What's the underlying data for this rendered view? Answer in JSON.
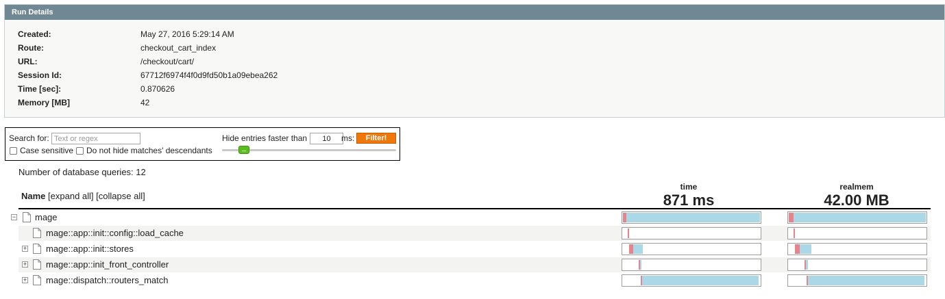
{
  "run_details": {
    "title": "Run Details",
    "rows": [
      {
        "label": "Created:",
        "value": "May 27, 2016 5:29:14 AM"
      },
      {
        "label": "Route:",
        "value": "checkout_cart_index"
      },
      {
        "label": "URL:",
        "value": "/checkout/cart/"
      },
      {
        "label": "Session Id:",
        "value": "67712f6974f4f0d9fd50b1a09ebea262"
      },
      {
        "label": "Time [sec]:",
        "value": "0.870626"
      },
      {
        "label": "Memory [MB]",
        "value": "42"
      }
    ]
  },
  "filter": {
    "search_label": "Search for:",
    "search_placeholder": "Text or regex",
    "case_sensitive_label": "Case sensitive",
    "no_hide_label": "Do not hide matches' descendants",
    "hide_label": "Hide entries faster than",
    "ms_value": "10",
    "ms_label": "ms:",
    "filter_button": "Filter!",
    "slider_glyph": "↔"
  },
  "db_queries": "Number of database queries: 12",
  "table": {
    "name_header": "Name",
    "expand_all": "[expand all]",
    "collapse_all": "[collapse all]",
    "time_header": "time",
    "time_total": "871 ms",
    "mem_header": "realmem",
    "mem_total": "42.00 MB",
    "rows": [
      {
        "label": "mage",
        "toggle": "−",
        "time": {
          "self": 0.025,
          "total": 1.0
        },
        "mem": {
          "self": 0.035,
          "total": 1.0
        }
      },
      {
        "label": "mage::app::init::config::load_cache",
        "toggle": "",
        "time": {
          "self": 0.01,
          "total": 0.01
        },
        "mem": {
          "self": 0.01,
          "total": 0.01
        }
      },
      {
        "label": "mage::app::init::stores",
        "toggle": "+",
        "time": {
          "self": 0.03,
          "total": 0.1
        },
        "mem": {
          "self": 0.035,
          "total": 0.12
        }
      },
      {
        "label": "mage::app::init_front_controller",
        "toggle": "+",
        "time": {
          "self": 0.01,
          "total": 0.02
        },
        "mem": {
          "self": 0.01,
          "total": 0.025
        }
      },
      {
        "label": "mage::dispatch::routers_match",
        "toggle": "+",
        "time": {
          "self": 0.01,
          "total": 0.86
        },
        "mem": {
          "self": 0.01,
          "total": 0.86
        }
      }
    ]
  },
  "colors": {
    "header_bg": "#708893",
    "self_bar": "#e8828c",
    "total_bar": "#aad8e6",
    "filter_button": "#f0780a",
    "slider_handle": "#5bbd1e"
  },
  "icons": {
    "row_file": "file-icon",
    "slider": "resize-horizontal-icon",
    "toggle_expand": "plus-box-icon",
    "toggle_collapse": "minus-box-icon"
  }
}
